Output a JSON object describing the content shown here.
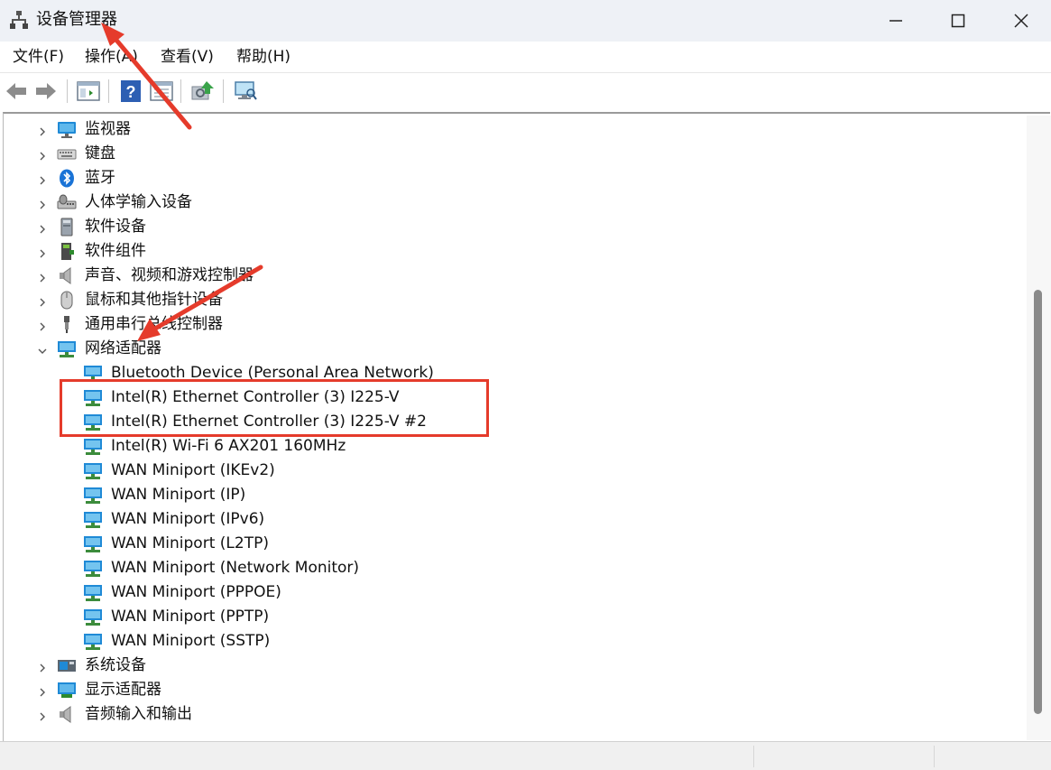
{
  "window": {
    "title": "设备管理器",
    "controls": {
      "minimize": "—",
      "maximize": "☐",
      "close": "✕"
    }
  },
  "menu": [
    "文件(F)",
    "操作(A)",
    "查看(V)",
    "帮助(H)"
  ],
  "toolbar": {
    "buttons": [
      "back-icon",
      "forward-icon",
      "properties-pane-icon",
      "help-icon",
      "view-toggle-icon",
      "update-driver-icon",
      "scan-hardware-icon"
    ]
  },
  "tree": {
    "categories_top": [
      {
        "label": "监视器",
        "icon": "monitor-icon"
      },
      {
        "label": "键盘",
        "icon": "keyboard-icon"
      },
      {
        "label": "蓝牙",
        "icon": "bluetooth-icon"
      },
      {
        "label": "人体学输入设备",
        "icon": "hid-icon"
      },
      {
        "label": "软件设备",
        "icon": "software-device-icon"
      },
      {
        "label": "软件组件",
        "icon": "software-component-icon"
      },
      {
        "label": "声音、视频和游戏控制器",
        "icon": "speaker-icon"
      },
      {
        "label": "鼠标和其他指针设备",
        "icon": "mouse-icon"
      },
      {
        "label": "通用串行总线控制器",
        "icon": "usb-icon"
      }
    ],
    "expanded": {
      "label": "网络适配器",
      "icon": "network-adapter-icon",
      "children": [
        "Bluetooth Device (Personal Area Network)",
        "Intel(R) Ethernet Controller (3) I225-V",
        "Intel(R) Ethernet Controller (3) I225-V #2",
        "Intel(R) Wi-Fi 6 AX201 160MHz",
        "WAN Miniport (IKEv2)",
        "WAN Miniport (IP)",
        "WAN Miniport (IPv6)",
        "WAN Miniport (L2TP)",
        "WAN Miniport (Network Monitor)",
        "WAN Miniport (PPPOE)",
        "WAN Miniport (PPTP)",
        "WAN Miniport (SSTP)"
      ]
    },
    "categories_bottom": [
      {
        "label": "系统设备",
        "icon": "system-device-icon"
      },
      {
        "label": "显示适配器",
        "icon": "display-adapter-icon"
      },
      {
        "label": "音频输入和输出",
        "icon": "audio-io-icon"
      }
    ]
  },
  "colors": {
    "annotation_red": "#e53b2b",
    "titlebar_bg": "#eef1f6",
    "monitor_blue": "#1f8ad6"
  }
}
